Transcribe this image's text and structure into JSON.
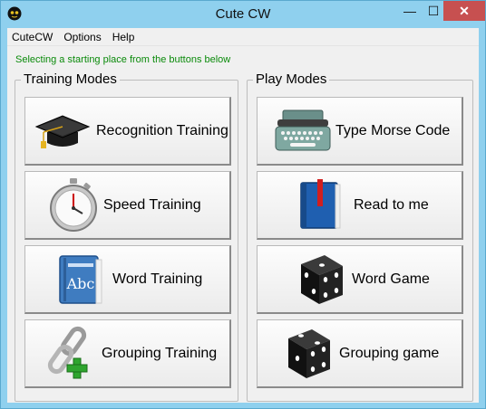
{
  "window": {
    "title": "Cute CW",
    "controls": {
      "minimize": "—",
      "maximize": "☐",
      "close": "✕"
    }
  },
  "menu": [
    "CuteCW",
    "Options",
    "Help"
  ],
  "hint": "Selecting a starting place from the buttons below",
  "training": {
    "title": "Training Modes",
    "buttons": [
      {
        "label": "Recognition Training",
        "icon": "graduation-cap-icon"
      },
      {
        "label": "Speed Training",
        "icon": "stopwatch-icon"
      },
      {
        "label": "Word Training",
        "icon": "dictionary-book-icon"
      },
      {
        "label": "Grouping Training",
        "icon": "chain-link-add-icon"
      }
    ]
  },
  "play": {
    "title": "Play Modes",
    "buttons": [
      {
        "label": "Type Morse Code",
        "icon": "typewriter-icon"
      },
      {
        "label": "Read to me",
        "icon": "blue-book-icon"
      },
      {
        "label": "Word Game",
        "icon": "dice-icon"
      },
      {
        "label": "Grouping game",
        "icon": "dice-icon"
      }
    ]
  },
  "colors": {
    "hint": "#0a8a0a",
    "titlebar": "#8fd0ee",
    "close": "#c75050"
  }
}
